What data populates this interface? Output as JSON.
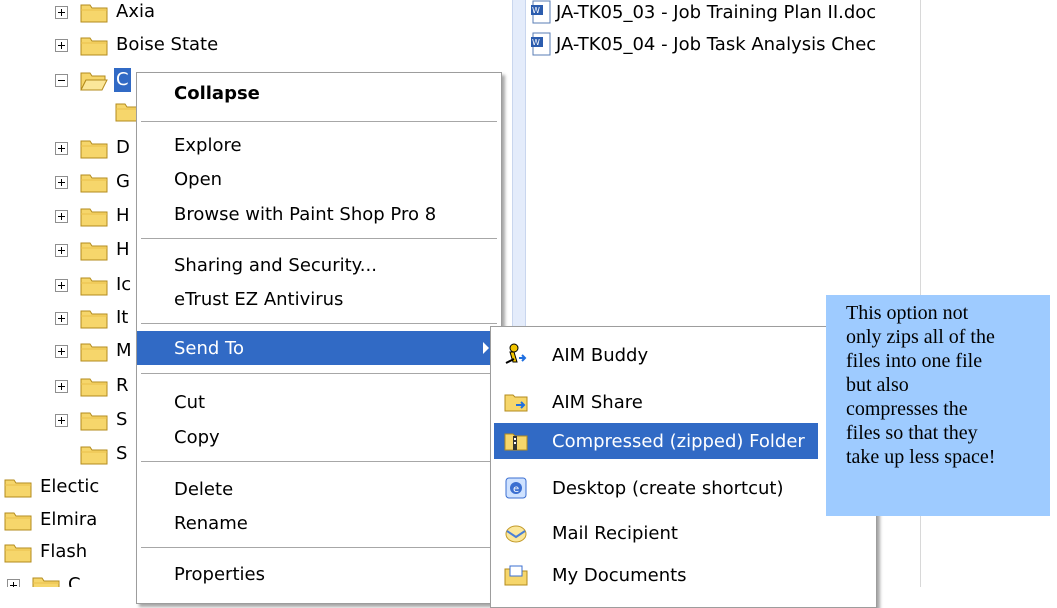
{
  "tree": {
    "items": [
      {
        "label": "Axia",
        "expander": "plus"
      },
      {
        "label": "Boise State",
        "expander": "plus"
      },
      {
        "label": "C",
        "expander": "minus",
        "selected": true
      },
      {
        "label": "",
        "expander": "none"
      },
      {
        "label": "D",
        "expander": "plus"
      },
      {
        "label": "G",
        "expander": "plus"
      },
      {
        "label": "H",
        "expander": "plus"
      },
      {
        "label": "H",
        "expander": "plus"
      },
      {
        "label": "Ic",
        "expander": "plus"
      },
      {
        "label": "It",
        "expander": "plus"
      },
      {
        "label": "M",
        "expander": "plus"
      },
      {
        "label": "R",
        "expander": "plus"
      },
      {
        "label": "S",
        "expander": "plus"
      },
      {
        "label": "S",
        "expander": "none"
      },
      {
        "label": "Electic",
        "expander": "none"
      },
      {
        "label": "Elmira",
        "expander": "none"
      },
      {
        "label": "Flash",
        "expander": "none"
      },
      {
        "label": "C",
        "expander": "plus"
      }
    ]
  },
  "files": [
    {
      "name": "JA-TK05_03 - Job Training Plan II.doc"
    },
    {
      "name": "JA-TK05_04 - Job Task Analysis Chec"
    }
  ],
  "context_menu": {
    "items": [
      {
        "label": "Collapse",
        "bold": true
      },
      {
        "label": "Explore"
      },
      {
        "label": "Open"
      },
      {
        "label": "Browse with Paint Shop Pro 8"
      },
      {
        "label": "Sharing and Security..."
      },
      {
        "label": "eTrust EZ Antivirus"
      },
      {
        "label": "Send To",
        "highlighted": true,
        "submenu": true
      },
      {
        "label": "Cut"
      },
      {
        "label": "Copy"
      },
      {
        "label": "Delete"
      },
      {
        "label": "Rename"
      },
      {
        "label": "Properties"
      }
    ]
  },
  "send_to_menu": {
    "items": [
      {
        "label": "AIM Buddy",
        "icon": "aim-buddy-icon"
      },
      {
        "label": "AIM Share",
        "icon": "aim-share-folder-icon"
      },
      {
        "label": "Compressed (zipped) Folder",
        "icon": "zip-folder-icon",
        "highlighted": true
      },
      {
        "label": "Desktop (create shortcut)",
        "icon": "desktop-shortcut-icon"
      },
      {
        "label": "Mail Recipient",
        "icon": "mail-recipient-icon"
      },
      {
        "label": "My Documents",
        "icon": "my-documents-icon"
      }
    ]
  },
  "callout": {
    "lines": [
      "This option not",
      "only zips all of the",
      "files into one file",
      "but also",
      "compresses the",
      "files so that they",
      "take up less space!"
    ]
  },
  "colors": {
    "selection": "#316ac5",
    "callout_bg": "#9ecbff",
    "folder_yellow": "#f6d66b"
  }
}
